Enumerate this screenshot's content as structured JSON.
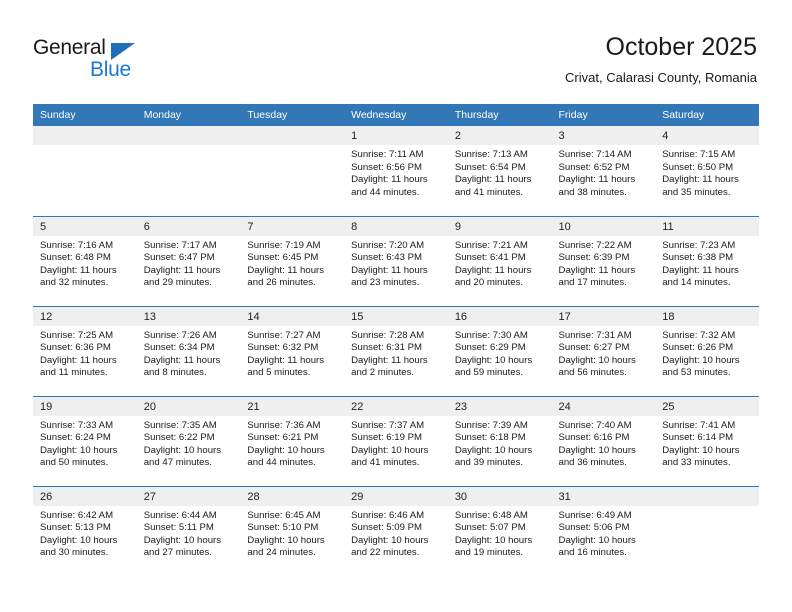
{
  "brand": {
    "name_part1": "General",
    "name_part2": "Blue",
    "accent_color": "#1e7ad1",
    "logo_triangle_color": "#1e6fb8"
  },
  "header": {
    "title": "October 2025",
    "subtitle": "Crivat, Calarasi County, Romania"
  },
  "theme": {
    "header_blue": "#3277b6",
    "day_strip_gray": "#efefef",
    "text_color": "#1a1a1a"
  },
  "weekday_headers": [
    "Sunday",
    "Monday",
    "Tuesday",
    "Wednesday",
    "Thursday",
    "Friday",
    "Saturday"
  ],
  "weeks": [
    [
      {
        "day": "",
        "sunrise": "",
        "sunset": "",
        "daylight_line1": "",
        "daylight_line2": "",
        "empty": true
      },
      {
        "day": "",
        "sunrise": "",
        "sunset": "",
        "daylight_line1": "",
        "daylight_line2": "",
        "empty": true
      },
      {
        "day": "",
        "sunrise": "",
        "sunset": "",
        "daylight_line1": "",
        "daylight_line2": "",
        "empty": true
      },
      {
        "day": "1",
        "sunrise": "Sunrise: 7:11 AM",
        "sunset": "Sunset: 6:56 PM",
        "daylight_line1": "Daylight: 11 hours",
        "daylight_line2": "and 44 minutes."
      },
      {
        "day": "2",
        "sunrise": "Sunrise: 7:13 AM",
        "sunset": "Sunset: 6:54 PM",
        "daylight_line1": "Daylight: 11 hours",
        "daylight_line2": "and 41 minutes."
      },
      {
        "day": "3",
        "sunrise": "Sunrise: 7:14 AM",
        "sunset": "Sunset: 6:52 PM",
        "daylight_line1": "Daylight: 11 hours",
        "daylight_line2": "and 38 minutes."
      },
      {
        "day": "4",
        "sunrise": "Sunrise: 7:15 AM",
        "sunset": "Sunset: 6:50 PM",
        "daylight_line1": "Daylight: 11 hours",
        "daylight_line2": "and 35 minutes."
      }
    ],
    [
      {
        "day": "5",
        "sunrise": "Sunrise: 7:16 AM",
        "sunset": "Sunset: 6:48 PM",
        "daylight_line1": "Daylight: 11 hours",
        "daylight_line2": "and 32 minutes."
      },
      {
        "day": "6",
        "sunrise": "Sunrise: 7:17 AM",
        "sunset": "Sunset: 6:47 PM",
        "daylight_line1": "Daylight: 11 hours",
        "daylight_line2": "and 29 minutes."
      },
      {
        "day": "7",
        "sunrise": "Sunrise: 7:19 AM",
        "sunset": "Sunset: 6:45 PM",
        "daylight_line1": "Daylight: 11 hours",
        "daylight_line2": "and 26 minutes."
      },
      {
        "day": "8",
        "sunrise": "Sunrise: 7:20 AM",
        "sunset": "Sunset: 6:43 PM",
        "daylight_line1": "Daylight: 11 hours",
        "daylight_line2": "and 23 minutes."
      },
      {
        "day": "9",
        "sunrise": "Sunrise: 7:21 AM",
        "sunset": "Sunset: 6:41 PM",
        "daylight_line1": "Daylight: 11 hours",
        "daylight_line2": "and 20 minutes."
      },
      {
        "day": "10",
        "sunrise": "Sunrise: 7:22 AM",
        "sunset": "Sunset: 6:39 PM",
        "daylight_line1": "Daylight: 11 hours",
        "daylight_line2": "and 17 minutes."
      },
      {
        "day": "11",
        "sunrise": "Sunrise: 7:23 AM",
        "sunset": "Sunset: 6:38 PM",
        "daylight_line1": "Daylight: 11 hours",
        "daylight_line2": "and 14 minutes."
      }
    ],
    [
      {
        "day": "12",
        "sunrise": "Sunrise: 7:25 AM",
        "sunset": "Sunset: 6:36 PM",
        "daylight_line1": "Daylight: 11 hours",
        "daylight_line2": "and 11 minutes."
      },
      {
        "day": "13",
        "sunrise": "Sunrise: 7:26 AM",
        "sunset": "Sunset: 6:34 PM",
        "daylight_line1": "Daylight: 11 hours",
        "daylight_line2": "and 8 minutes."
      },
      {
        "day": "14",
        "sunrise": "Sunrise: 7:27 AM",
        "sunset": "Sunset: 6:32 PM",
        "daylight_line1": "Daylight: 11 hours",
        "daylight_line2": "and 5 minutes."
      },
      {
        "day": "15",
        "sunrise": "Sunrise: 7:28 AM",
        "sunset": "Sunset: 6:31 PM",
        "daylight_line1": "Daylight: 11 hours",
        "daylight_line2": "and 2 minutes."
      },
      {
        "day": "16",
        "sunrise": "Sunrise: 7:30 AM",
        "sunset": "Sunset: 6:29 PM",
        "daylight_line1": "Daylight: 10 hours",
        "daylight_line2": "and 59 minutes."
      },
      {
        "day": "17",
        "sunrise": "Sunrise: 7:31 AM",
        "sunset": "Sunset: 6:27 PM",
        "daylight_line1": "Daylight: 10 hours",
        "daylight_line2": "and 56 minutes."
      },
      {
        "day": "18",
        "sunrise": "Sunrise: 7:32 AM",
        "sunset": "Sunset: 6:26 PM",
        "daylight_line1": "Daylight: 10 hours",
        "daylight_line2": "and 53 minutes."
      }
    ],
    [
      {
        "day": "19",
        "sunrise": "Sunrise: 7:33 AM",
        "sunset": "Sunset: 6:24 PM",
        "daylight_line1": "Daylight: 10 hours",
        "daylight_line2": "and 50 minutes."
      },
      {
        "day": "20",
        "sunrise": "Sunrise: 7:35 AM",
        "sunset": "Sunset: 6:22 PM",
        "daylight_line1": "Daylight: 10 hours",
        "daylight_line2": "and 47 minutes."
      },
      {
        "day": "21",
        "sunrise": "Sunrise: 7:36 AM",
        "sunset": "Sunset: 6:21 PM",
        "daylight_line1": "Daylight: 10 hours",
        "daylight_line2": "and 44 minutes."
      },
      {
        "day": "22",
        "sunrise": "Sunrise: 7:37 AM",
        "sunset": "Sunset: 6:19 PM",
        "daylight_line1": "Daylight: 10 hours",
        "daylight_line2": "and 41 minutes."
      },
      {
        "day": "23",
        "sunrise": "Sunrise: 7:39 AM",
        "sunset": "Sunset: 6:18 PM",
        "daylight_line1": "Daylight: 10 hours",
        "daylight_line2": "and 39 minutes."
      },
      {
        "day": "24",
        "sunrise": "Sunrise: 7:40 AM",
        "sunset": "Sunset: 6:16 PM",
        "daylight_line1": "Daylight: 10 hours",
        "daylight_line2": "and 36 minutes."
      },
      {
        "day": "25",
        "sunrise": "Sunrise: 7:41 AM",
        "sunset": "Sunset: 6:14 PM",
        "daylight_line1": "Daylight: 10 hours",
        "daylight_line2": "and 33 minutes."
      }
    ],
    [
      {
        "day": "26",
        "sunrise": "Sunrise: 6:42 AM",
        "sunset": "Sunset: 5:13 PM",
        "daylight_line1": "Daylight: 10 hours",
        "daylight_line2": "and 30 minutes."
      },
      {
        "day": "27",
        "sunrise": "Sunrise: 6:44 AM",
        "sunset": "Sunset: 5:11 PM",
        "daylight_line1": "Daylight: 10 hours",
        "daylight_line2": "and 27 minutes."
      },
      {
        "day": "28",
        "sunrise": "Sunrise: 6:45 AM",
        "sunset": "Sunset: 5:10 PM",
        "daylight_line1": "Daylight: 10 hours",
        "daylight_line2": "and 24 minutes."
      },
      {
        "day": "29",
        "sunrise": "Sunrise: 6:46 AM",
        "sunset": "Sunset: 5:09 PM",
        "daylight_line1": "Daylight: 10 hours",
        "daylight_line2": "and 22 minutes."
      },
      {
        "day": "30",
        "sunrise": "Sunrise: 6:48 AM",
        "sunset": "Sunset: 5:07 PM",
        "daylight_line1": "Daylight: 10 hours",
        "daylight_line2": "and 19 minutes."
      },
      {
        "day": "31",
        "sunrise": "Sunrise: 6:49 AM",
        "sunset": "Sunset: 5:06 PM",
        "daylight_line1": "Daylight: 10 hours",
        "daylight_line2": "and 16 minutes."
      },
      {
        "day": "",
        "sunrise": "",
        "sunset": "",
        "daylight_line1": "",
        "daylight_line2": "",
        "empty": true
      }
    ]
  ]
}
